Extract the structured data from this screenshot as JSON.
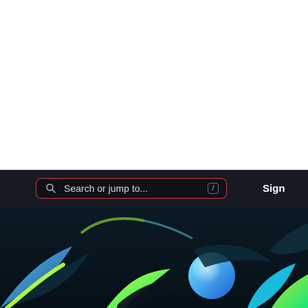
{
  "header": {
    "search": {
      "placeholder": "Search or jump to...",
      "shortcut_key": "/"
    },
    "signin_label": "Sign"
  },
  "icons": {
    "search": "search-icon",
    "hero": "hero-illustration"
  },
  "colors": {
    "header_bg": "#171a20",
    "search_border": "#c83c4a",
    "hero_bg_dark": "#07131c",
    "hero_accent_blue": "#3ad6ff",
    "hero_accent_green": "#44ff55"
  }
}
